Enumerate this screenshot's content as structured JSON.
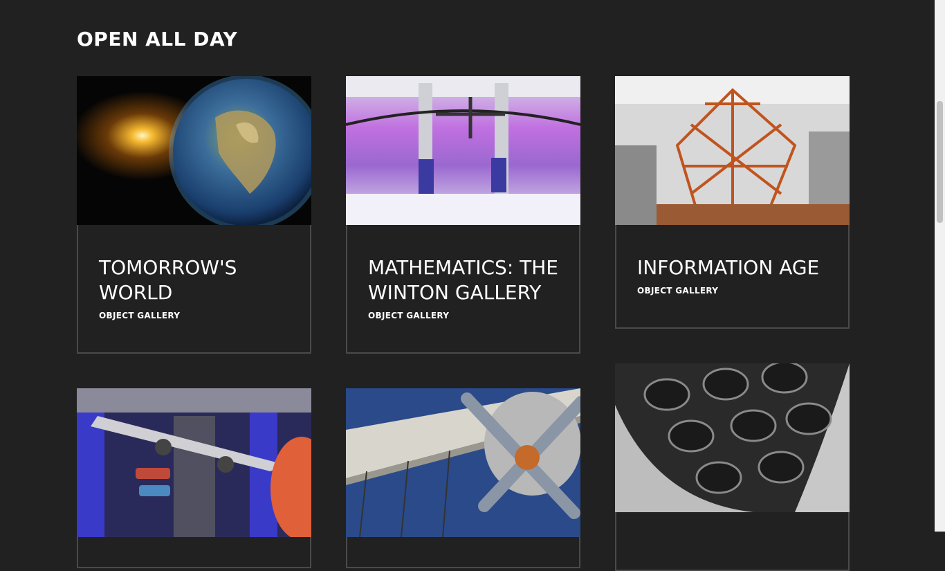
{
  "section": {
    "title": "OPEN ALL DAY"
  },
  "cards": [
    {
      "title": "TOMORROW'S WORLD",
      "type": "OBJECT GALLERY",
      "image": "earth-in-space-image"
    },
    {
      "title": "MATHEMATICS: THE WINTON GALLERY",
      "type": "OBJECT GALLERY",
      "image": "gallery-interior-with-aircraft-image"
    },
    {
      "title": "INFORMATION AGE",
      "type": "OBJECT GALLERY",
      "image": "copper-radio-structure-image"
    },
    {
      "title": "",
      "type": "",
      "image": "aircraft-hall-with-cars-image"
    },
    {
      "title": "",
      "type": "",
      "image": "biplane-propeller-image"
    },
    {
      "title": "",
      "type": "",
      "image": "rocket-engines-image"
    }
  ]
}
